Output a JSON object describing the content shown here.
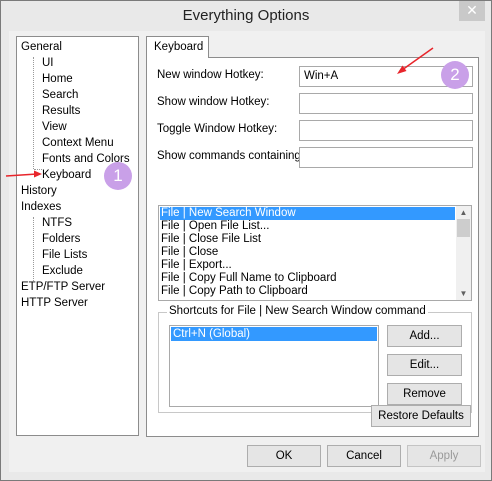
{
  "window": {
    "title": "Everything Options",
    "close_glyph": "✕"
  },
  "tree": {
    "items": [
      {
        "label": "General"
      },
      {
        "label": "UI"
      },
      {
        "label": "Home"
      },
      {
        "label": "Search"
      },
      {
        "label": "Results"
      },
      {
        "label": "View"
      },
      {
        "label": "Context Menu"
      },
      {
        "label": "Fonts and Colors"
      },
      {
        "label": "Keyboard",
        "selected": true
      },
      {
        "label": "History"
      },
      {
        "label": "Indexes"
      },
      {
        "label": "NTFS"
      },
      {
        "label": "Folders"
      },
      {
        "label": "File Lists"
      },
      {
        "label": "Exclude"
      },
      {
        "label": "ETP/FTP Server"
      },
      {
        "label": "HTTP Server"
      }
    ]
  },
  "tab": {
    "label": "Keyboard"
  },
  "form": {
    "new_window_label": "New window Hotkey:",
    "new_window_value": "Win+A",
    "show_window_label": "Show window Hotkey:",
    "show_window_value": "",
    "toggle_window_label": "Toggle Window Hotkey:",
    "toggle_window_value": "",
    "show_commands_label": "Show commands containing:",
    "show_commands_value": ""
  },
  "commands": [
    {
      "label": "File | New Search Window",
      "selected": true
    },
    {
      "label": "File | Open File List..."
    },
    {
      "label": "File | Close File List"
    },
    {
      "label": "File | Close"
    },
    {
      "label": "File | Export..."
    },
    {
      "label": "File | Copy Full Name to Clipboard"
    },
    {
      "label": "File | Copy Path to Clipboard"
    }
  ],
  "shortcuts": {
    "group_title": "Shortcuts for File | New Search Window command",
    "items": [
      "Ctrl+N (Global)"
    ],
    "add_label": "Add...",
    "edit_label": "Edit...",
    "remove_label": "Remove"
  },
  "restore_defaults_label": "Restore Defaults",
  "footer": {
    "ok_label": "OK",
    "cancel_label": "Cancel",
    "apply_label": "Apply"
  },
  "annotations": {
    "badge_1": "1",
    "badge_2": "2",
    "arrow_color": "#e8252b",
    "badge_color": "#c9a0e8"
  }
}
